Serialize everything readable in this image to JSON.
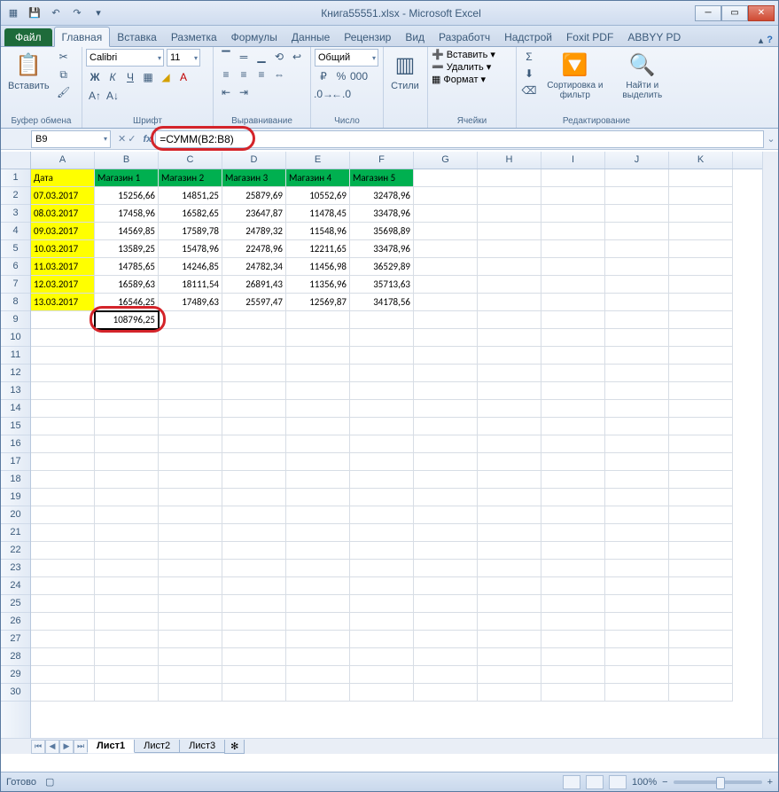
{
  "window": {
    "title": "Книга55551.xlsx - Microsoft Excel"
  },
  "qat": {
    "save": "💾",
    "undo": "↶",
    "redo": "↷"
  },
  "ribbon": {
    "file": "Файл",
    "tabs": [
      "Главная",
      "Вставка",
      "Разметка",
      "Формулы",
      "Данные",
      "Рецензир",
      "Вид",
      "Разработч",
      "Надстрой",
      "Foxit PDF",
      "ABBYY PD"
    ],
    "active": 0,
    "groups": {
      "clipboard": {
        "label": "Буфер обмена",
        "paste": "Вставить"
      },
      "font": {
        "label": "Шрифт",
        "name": "Calibri",
        "size": "11"
      },
      "align": {
        "label": "Выравнивание"
      },
      "number": {
        "label": "Число",
        "format": "Общий"
      },
      "styles": {
        "label": "Стили",
        "btn": "Стили"
      },
      "cells": {
        "label": "Ячейки",
        "insert": "Вставить",
        "delete": "Удалить",
        "format": "Формат"
      },
      "editing": {
        "label": "Редактирование",
        "sort": "Сортировка и фильтр",
        "find": "Найти и выделить"
      }
    }
  },
  "fbar": {
    "namebox": "B9",
    "formula": "=СУММ(B2:B8)"
  },
  "columns": [
    "A",
    "B",
    "C",
    "D",
    "E",
    "F",
    "G",
    "H",
    "I",
    "J",
    "K"
  ],
  "rowCount": 30,
  "data": {
    "headers": [
      "Дата",
      "Магазин 1",
      "Магазин 2",
      "Магазин 3",
      "Магазин 4",
      "Магазин 5"
    ],
    "rows": [
      [
        "07.03.2017",
        "15256,66",
        "14851,25",
        "25879,69",
        "10552,69",
        "32478,96"
      ],
      [
        "08.03.2017",
        "17458,96",
        "16582,65",
        "23647,87",
        "11478,45",
        "33478,96"
      ],
      [
        "09.03.2017",
        "14569,85",
        "17589,78",
        "24789,32",
        "11548,96",
        "35698,89"
      ],
      [
        "10.03.2017",
        "13589,25",
        "15478,96",
        "22478,96",
        "12211,65",
        "33478,96"
      ],
      [
        "11.03.2017",
        "14785,65",
        "14246,85",
        "24782,34",
        "11456,98",
        "36529,89"
      ],
      [
        "12.03.2017",
        "16589,63",
        "18111,54",
        "26891,43",
        "11356,96",
        "35713,63"
      ],
      [
        "13.03.2017",
        "16546,25",
        "17489,63",
        "25597,47",
        "12569,87",
        "34178,56"
      ]
    ],
    "sum": {
      "col": "B",
      "row": 9,
      "value": "108796,25"
    }
  },
  "sheets": {
    "tabs": [
      "Лист1",
      "Лист2",
      "Лист3"
    ],
    "active": 0
  },
  "status": {
    "ready": "Готово",
    "zoom": "100%"
  }
}
